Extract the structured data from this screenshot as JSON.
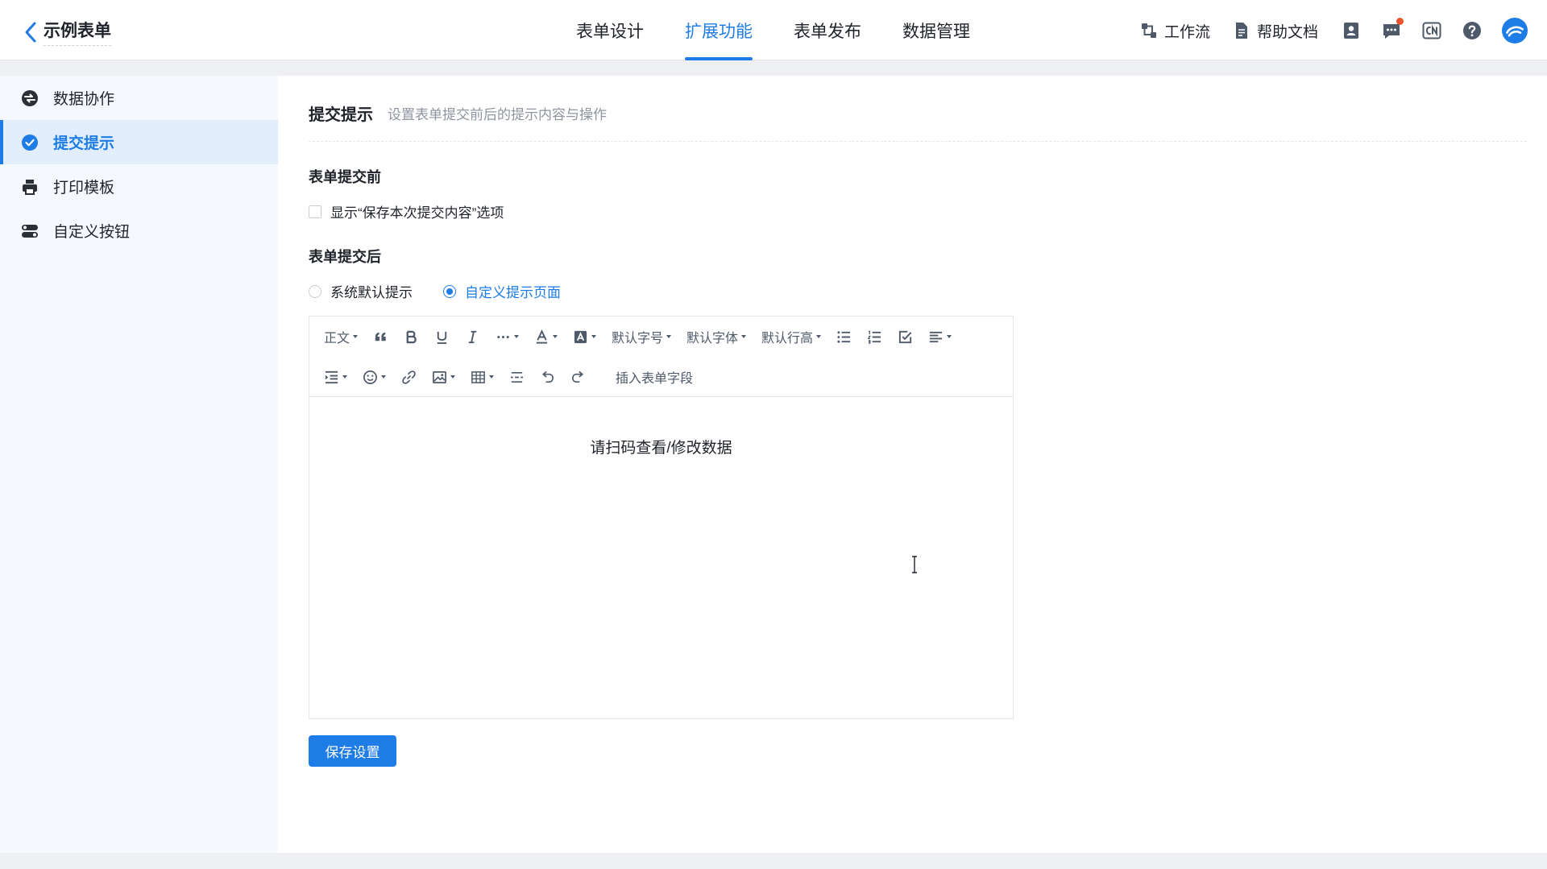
{
  "header": {
    "back_icon": "chevron-left-icon",
    "title": "示例表单",
    "tabs": [
      {
        "label": "表单设计",
        "active": false
      },
      {
        "label": "扩展功能",
        "active": true
      },
      {
        "label": "表单发布",
        "active": false
      },
      {
        "label": "数据管理",
        "active": false
      }
    ],
    "links": [
      {
        "label": "工作流",
        "icon": "workflow-icon"
      },
      {
        "label": "帮助文档",
        "icon": "document-icon"
      }
    ],
    "icons": [
      "contacts-icon",
      "message-icon",
      "language-cn-icon",
      "help-icon",
      "avatar-icon"
    ],
    "accent_color": "#1e7ce6",
    "notification_color": "#e8542e"
  },
  "sidebar": {
    "items": [
      {
        "label": "数据协作",
        "icon": "data-collab-icon",
        "active": false
      },
      {
        "label": "提交提示",
        "icon": "check-circle-icon",
        "active": true
      },
      {
        "label": "打印模板",
        "icon": "printer-icon",
        "active": false
      },
      {
        "label": "自定义按钮",
        "icon": "toggle-buttons-icon",
        "active": false
      }
    ]
  },
  "main": {
    "title": "提交提示",
    "description": "设置表单提交前后的提示内容与操作",
    "before": {
      "title": "表单提交前",
      "checkbox_label": "显示“保存本次提交内容”选项",
      "checked": false
    },
    "after": {
      "title": "表单提交后",
      "options": [
        {
          "label": "系统默认提示",
          "selected": false
        },
        {
          "label": "自定义提示页面",
          "selected": true
        }
      ]
    },
    "editor": {
      "toolbar": {
        "paragraph": "正文",
        "font_size": "默认字号",
        "font_family": "默认字体",
        "line_height": "默认行高",
        "insert_field": "插入表单字段"
      },
      "content": "请扫码查看/修改数据"
    },
    "save_label": "保存设置"
  }
}
